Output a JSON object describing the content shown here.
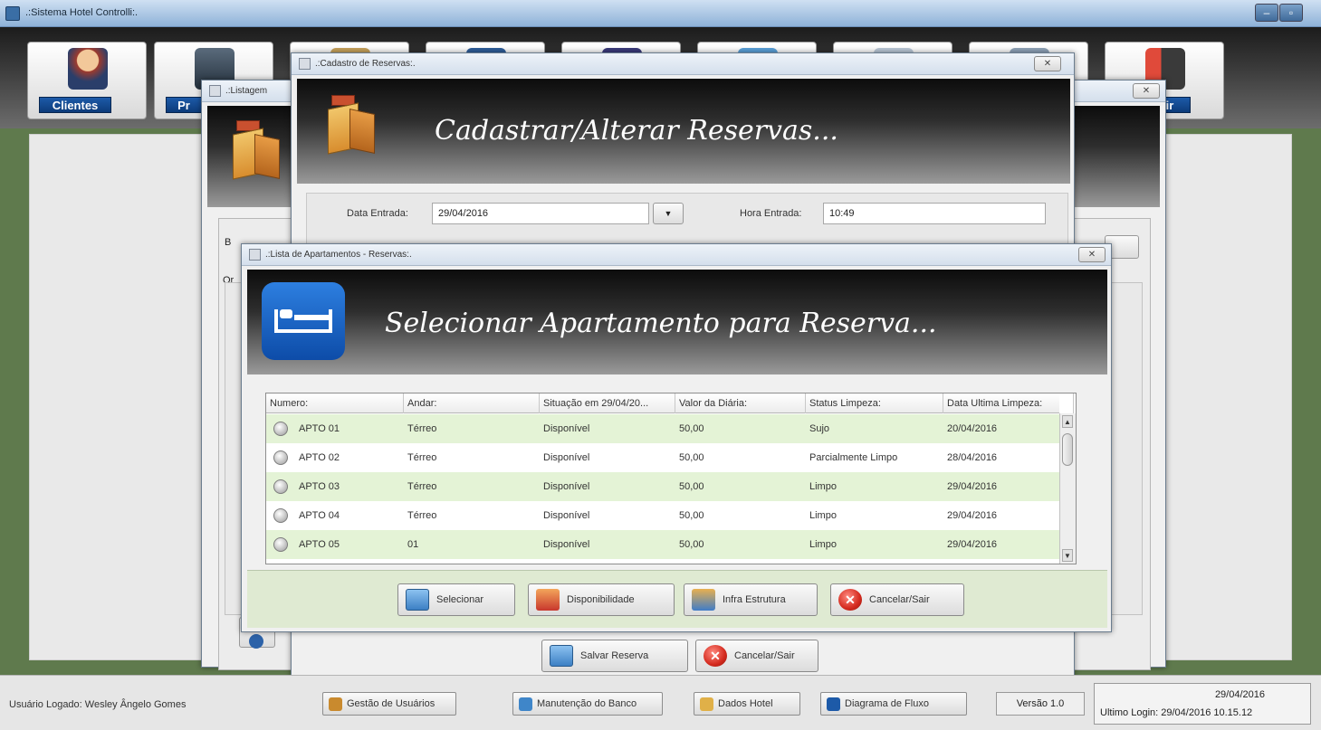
{
  "app": {
    "title": ".:Sistema Hotel Controlli:.",
    "toolbar": [
      {
        "label": "Clientes",
        "icon": "client-icon"
      },
      {
        "label": "Pr",
        "icon": "food-icon"
      },
      {
        "label": "",
        "icon": "toolbar-icon-3"
      },
      {
        "label": "",
        "icon": "toolbar-icon-4"
      },
      {
        "label": "",
        "icon": "toolbar-icon-5"
      },
      {
        "label": "",
        "icon": "toolbar-icon-6"
      },
      {
        "label": "",
        "icon": "toolbar-icon-7"
      },
      {
        "label": "",
        "icon": "toolbar-icon-8"
      },
      {
        "label": "ir",
        "icon": "exit-door-icon"
      }
    ]
  },
  "statusbar": {
    "user": "Usuário Logado: Wesley Ângelo Gomes",
    "buttons": [
      {
        "label": "Gestão de Usuários",
        "color": "#c98a2e"
      },
      {
        "label": "Manutenção do Banco",
        "color": "#3f86c9"
      },
      {
        "label": "Dados Hotel",
        "color": "#e0b048"
      },
      {
        "label": "Diagrama de Fluxo",
        "color": "#1d5aa8"
      }
    ],
    "version": "Versão 1.0",
    "date": "29/04/2016",
    "last_login": "Ultimo Login: 29/04/2016 10.15.12"
  },
  "listing_window": {
    "title": ".:Listagem",
    "search_prefix": "B",
    "label_prefix": "Or"
  },
  "reserva_window": {
    "title": ".:Cadastro de Reservas:.",
    "banner": "Cadastrar/Alterar Reservas...",
    "data_entrada_label": "Data Entrada:",
    "data_entrada_value": "29/04/2016",
    "hora_entrada_label": "Hora Entrada:",
    "hora_entrada_value": "10:49",
    "save_label": "Salvar Reserva",
    "cancel_label": "Cancelar/Sair"
  },
  "apartment_window": {
    "title": ".:Lista de Apartamentos - Reservas:.",
    "banner": "Selecionar Apartamento para Reserva...",
    "columns": [
      "Numero:",
      "Andar:",
      "Situação em 29/04/20...",
      "Valor da Diária:",
      "Status Limpeza:",
      "Data Ultima Limpeza:"
    ],
    "rows": [
      {
        "numero": "APTO 01",
        "andar": "Térreo",
        "situacao": "Disponível",
        "valor": "50,00",
        "status": "Sujo",
        "data": "20/04/2016"
      },
      {
        "numero": "APTO 02",
        "andar": "Térreo",
        "situacao": "Disponível",
        "valor": "50,00",
        "status": "Parcialmente Limpo",
        "data": "28/04/2016"
      },
      {
        "numero": "APTO 03",
        "andar": "Térreo",
        "situacao": "Disponível",
        "valor": "50,00",
        "status": "Limpo",
        "data": "29/04/2016"
      },
      {
        "numero": "APTO 04",
        "andar": "Térreo",
        "situacao": "Disponível",
        "valor": "50,00",
        "status": "Limpo",
        "data": "29/04/2016"
      },
      {
        "numero": "APTO 05",
        "andar": "01",
        "situacao": "Disponível",
        "valor": "50,00",
        "status": "Limpo",
        "data": "29/04/2016"
      }
    ],
    "buttons": {
      "select": "Selecionar",
      "availability": "Disponibilidade",
      "infra": "Infra Estrutura",
      "cancel": "Cancelar/Sair"
    }
  }
}
